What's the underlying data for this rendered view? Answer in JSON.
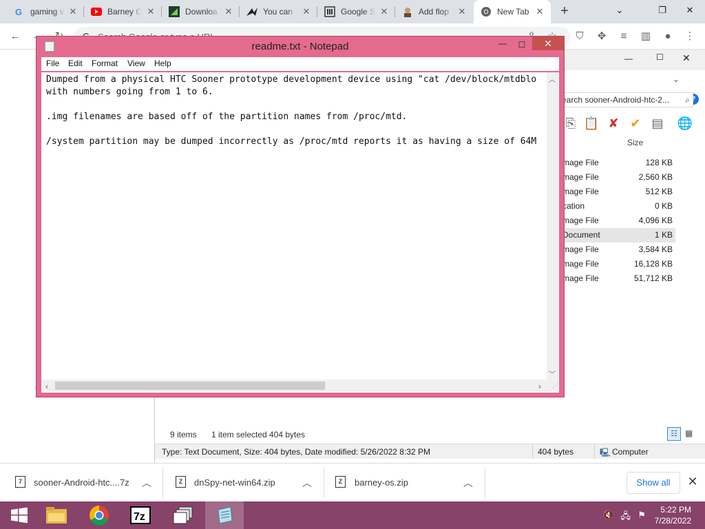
{
  "chrome": {
    "tabs": [
      {
        "title": "gaming v",
        "icon": "google-icon"
      },
      {
        "title": "Barney C",
        "icon": "youtube-icon"
      },
      {
        "title": "Downloa",
        "icon": "download-site-icon"
      },
      {
        "title": "You can",
        "icon": "bird-icon"
      },
      {
        "title": "Google S",
        "icon": "google-scholar-icon"
      },
      {
        "title": "Add flop",
        "icon": "avatar-icon"
      },
      {
        "title": "New Tab",
        "icon": "chrome-icon",
        "active": true
      }
    ],
    "newtab_label": "+",
    "omnibox_placeholder": "Search Google or type a URL"
  },
  "notepad": {
    "title": "readme.txt - Notepad",
    "menu": [
      "File",
      "Edit",
      "Format",
      "View",
      "Help"
    ],
    "lines": [
      "Dumped from a physical HTC Sooner prototype development device using \"cat /dev/block/mtdblo",
      "with numbers going from 1 to 6.",
      "",
      ".img filenames are based off of the partition names from /proc/mtd.",
      "",
      "/system partition may be dumped incorrectly as /proc/mtd reports it as having a size of 64M"
    ]
  },
  "explorer": {
    "search_text": "earch sooner-Android-htc-2...",
    "size_header": "Size",
    "files": [
      {
        "type": "mage File",
        "size": "128 KB"
      },
      {
        "type": "mage File",
        "size": "2,560 KB"
      },
      {
        "type": "mage File",
        "size": "512 KB"
      },
      {
        "type": "cation",
        "size": "0 KB"
      },
      {
        "type": "mage File",
        "size": "4,096 KB"
      },
      {
        "type": "Document",
        "size": "1 KB",
        "selected": true
      },
      {
        "type": "mage File",
        "size": "3,584 KB"
      },
      {
        "type": "mage File",
        "size": "16,128 KB"
      },
      {
        "type": "mage File",
        "size": "51,712 KB"
      }
    ],
    "status": {
      "items": "9 items",
      "selected": "1 item selected",
      "selected_size": "404 bytes"
    },
    "details": {
      "info": "Type: Text Document, Size: 404 bytes, Date modified: 5/26/2022 8:32 PM",
      "size": "404 bytes",
      "location": "Computer"
    }
  },
  "downloads": {
    "items": [
      {
        "name": "sooner-Android-htc....7z"
      },
      {
        "name": "dnSpy-net-win64.zip"
      },
      {
        "name": "barney-os.zip"
      }
    ],
    "show_all": "Show all"
  },
  "taskbar": {
    "time": "5:22 PM",
    "date": "7/28/2022"
  },
  "colors": {
    "notepad_frame": "#e46a8f",
    "taskbar": "#87436a",
    "link_blue": "#1a73e8"
  }
}
